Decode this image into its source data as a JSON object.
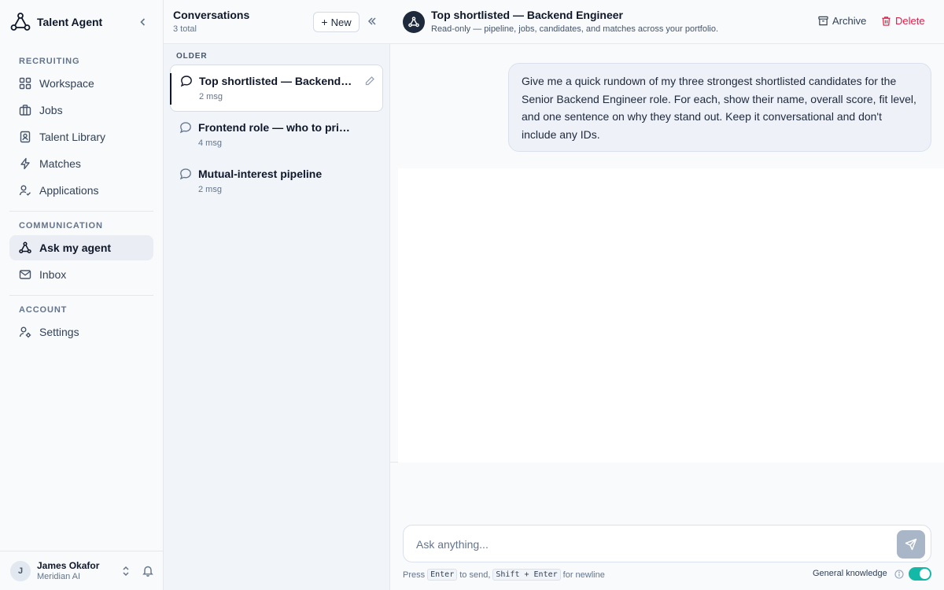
{
  "app": {
    "name": "Talent Agent"
  },
  "sidebar": {
    "sections": [
      {
        "title": "RECRUITING",
        "items": [
          {
            "label": "Workspace",
            "icon": "grid-icon"
          },
          {
            "label": "Jobs",
            "icon": "briefcase-icon"
          },
          {
            "label": "Talent Library",
            "icon": "contact-book-icon"
          },
          {
            "label": "Matches",
            "icon": "lightning-icon"
          },
          {
            "label": "Applications",
            "icon": "user-check-icon"
          }
        ]
      },
      {
        "title": "COMMUNICATION",
        "items": [
          {
            "label": "Ask my agent",
            "icon": "agent-icon",
            "active": true
          },
          {
            "label": "Inbox",
            "icon": "mail-icon"
          }
        ]
      },
      {
        "title": "ACCOUNT",
        "items": [
          {
            "label": "Settings",
            "icon": "user-gear-icon"
          }
        ]
      }
    ],
    "user": {
      "initial": "J",
      "name": "James Okafor",
      "org": "Meridian AI"
    }
  },
  "conversations": {
    "title": "Conversations",
    "count_label": "3 total",
    "new_label": "New",
    "group_label": "OLDER",
    "items": [
      {
        "title": "Top shortlisted — Backend Engineer",
        "meta": "2 msg",
        "active": true
      },
      {
        "title": "Frontend role — who to prioritize",
        "meta": "4 msg"
      },
      {
        "title": "Mutual-interest pipeline",
        "meta": "2 msg"
      }
    ]
  },
  "chat": {
    "title": "Top shortlisted — Backend Engineer",
    "subtitle": "Read-only — pipeline, jobs, candidates, and matches across your portfolio.",
    "archive_label": "Archive",
    "delete_label": "Delete",
    "messages": [
      {
        "role": "user",
        "text": "Give me a quick rundown of my three strongest shortlisted candidates for the Senior Backend Engineer role. For each, show their name, overall score, fit level, and one sentence on why they stand out. Keep it conversational and don't include any IDs."
      }
    ],
    "composer": {
      "placeholder": "Ask anything...",
      "hint_prefix": "Press",
      "hint_key1": "Enter",
      "hint_mid": "to send,",
      "hint_key2": "Shift + Enter",
      "hint_suffix": "for newline",
      "general_knowledge_label": "General knowledge",
      "general_knowledge_on": true
    }
  },
  "colors": {
    "accent_toggle": "#14b8a6",
    "delete": "#e11d48",
    "dark": "#0f172a"
  }
}
